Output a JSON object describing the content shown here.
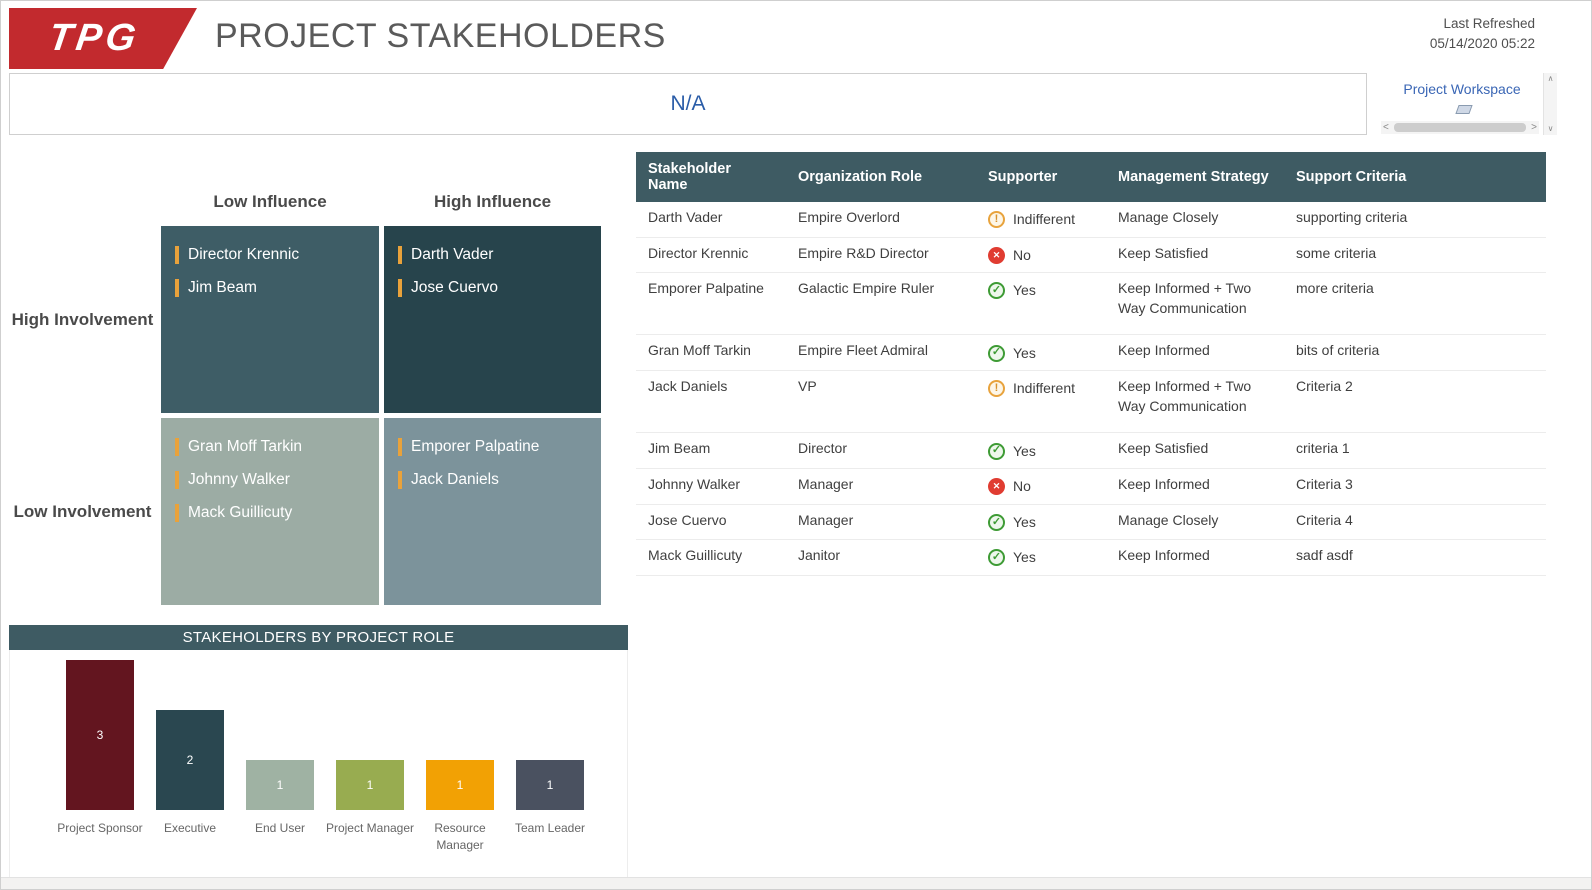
{
  "header": {
    "logo": "TPG",
    "title": "PROJECT STAKEHOLDERS",
    "refreshed_label": "Last Refreshed",
    "refreshed_value": "05/14/2020 05:22"
  },
  "filters": {
    "selection": "N/A",
    "workspace_label": "Project Workspace"
  },
  "colors": {
    "brand_red": "#C22A2E",
    "teal_header": "#3E5B63",
    "accent_orange": "#E9A23B",
    "link_blue": "#3A66B5",
    "quad_high_inv_low_inf": "#3E5D66",
    "quad_high_inv_high_inf": "#27444C",
    "quad_low_inv_low_inf": "#9CACA4",
    "quad_low_inv_high_inf": "#7C939B",
    "status_yes": "#3E9B35",
    "status_no": "#E03C31",
    "status_indifferent": "#E8A33D"
  },
  "matrix": {
    "col_low": "Low Influence",
    "col_high": "High Influence",
    "row_high": "High Involvement",
    "row_low": "Low Involvement",
    "quadrants": {
      "hi_low": [
        "Director Krennic",
        "Jim Beam"
      ],
      "hi_high": [
        "Darth Vader",
        "Jose Cuervo"
      ],
      "lo_low": [
        "Gran Moff Tarkin",
        "Johnny Walker",
        "Mack Guillicuty"
      ],
      "lo_high": [
        "Emporer Palpatine",
        "Jack Daniels"
      ]
    }
  },
  "chart_data": {
    "type": "bar",
    "title": "STAKEHOLDERS BY PROJECT ROLE",
    "categories": [
      "Project Sponsor",
      "Executive",
      "End User",
      "Project Manager",
      "Resource Manager",
      "Team Leader"
    ],
    "values": [
      3,
      2,
      1,
      1,
      1,
      1
    ],
    "colors": [
      "#63151F",
      "#2A4750",
      "#9FB2A3",
      "#98AC50",
      "#F2A104",
      "#4A5160"
    ],
    "xlabel": "",
    "ylabel": "",
    "ylim": [
      0,
      3
    ],
    "grid": false,
    "legend": "none"
  },
  "table": {
    "columns": [
      "Stakeholder Name",
      "Organization Role",
      "Supporter",
      "Management Strategy",
      "Support Criteria"
    ],
    "rows": [
      {
        "name": "Darth Vader",
        "role": "Empire Overlord",
        "supporter": "Indifferent",
        "status": "indifferent",
        "strategy": "Manage Closely",
        "criteria": "supporting criteria"
      },
      {
        "name": "Director Krennic",
        "role": "Empire R&D Director",
        "supporter": "No",
        "status": "no",
        "strategy": "Keep Satisfied",
        "criteria": "some criteria"
      },
      {
        "name": "Emporer Palpatine",
        "role": "Galactic Empire Ruler",
        "supporter": "Yes",
        "status": "yes",
        "strategy": "Keep Informed + Two Way Communication",
        "criteria": "more criteria"
      },
      {
        "name": "Gran Moff Tarkin",
        "role": "Empire Fleet Admiral",
        "supporter": "Yes",
        "status": "yes",
        "strategy": "Keep Informed",
        "criteria": "bits of criteria"
      },
      {
        "name": "Jack Daniels",
        "role": "VP",
        "supporter": "Indifferent",
        "status": "indifferent",
        "strategy": "Keep Informed + Two Way Communication",
        "criteria": "Criteria 2"
      },
      {
        "name": "Jim Beam",
        "role": "Director",
        "supporter": "Yes",
        "status": "yes",
        "strategy": "Keep Satisfied",
        "criteria": "criteria 1"
      },
      {
        "name": "Johnny Walker",
        "role": "Manager",
        "supporter": "No",
        "status": "no",
        "strategy": "Keep Informed",
        "criteria": "Criteria 3"
      },
      {
        "name": "Jose Cuervo",
        "role": "Manager",
        "supporter": "Yes",
        "status": "yes",
        "strategy": "Manage Closely",
        "criteria": "Criteria 4"
      },
      {
        "name": "Mack Guillicuty",
        "role": "Janitor",
        "supporter": "Yes",
        "status": "yes",
        "strategy": "Keep Informed",
        "criteria": "sadf asdf"
      }
    ]
  }
}
